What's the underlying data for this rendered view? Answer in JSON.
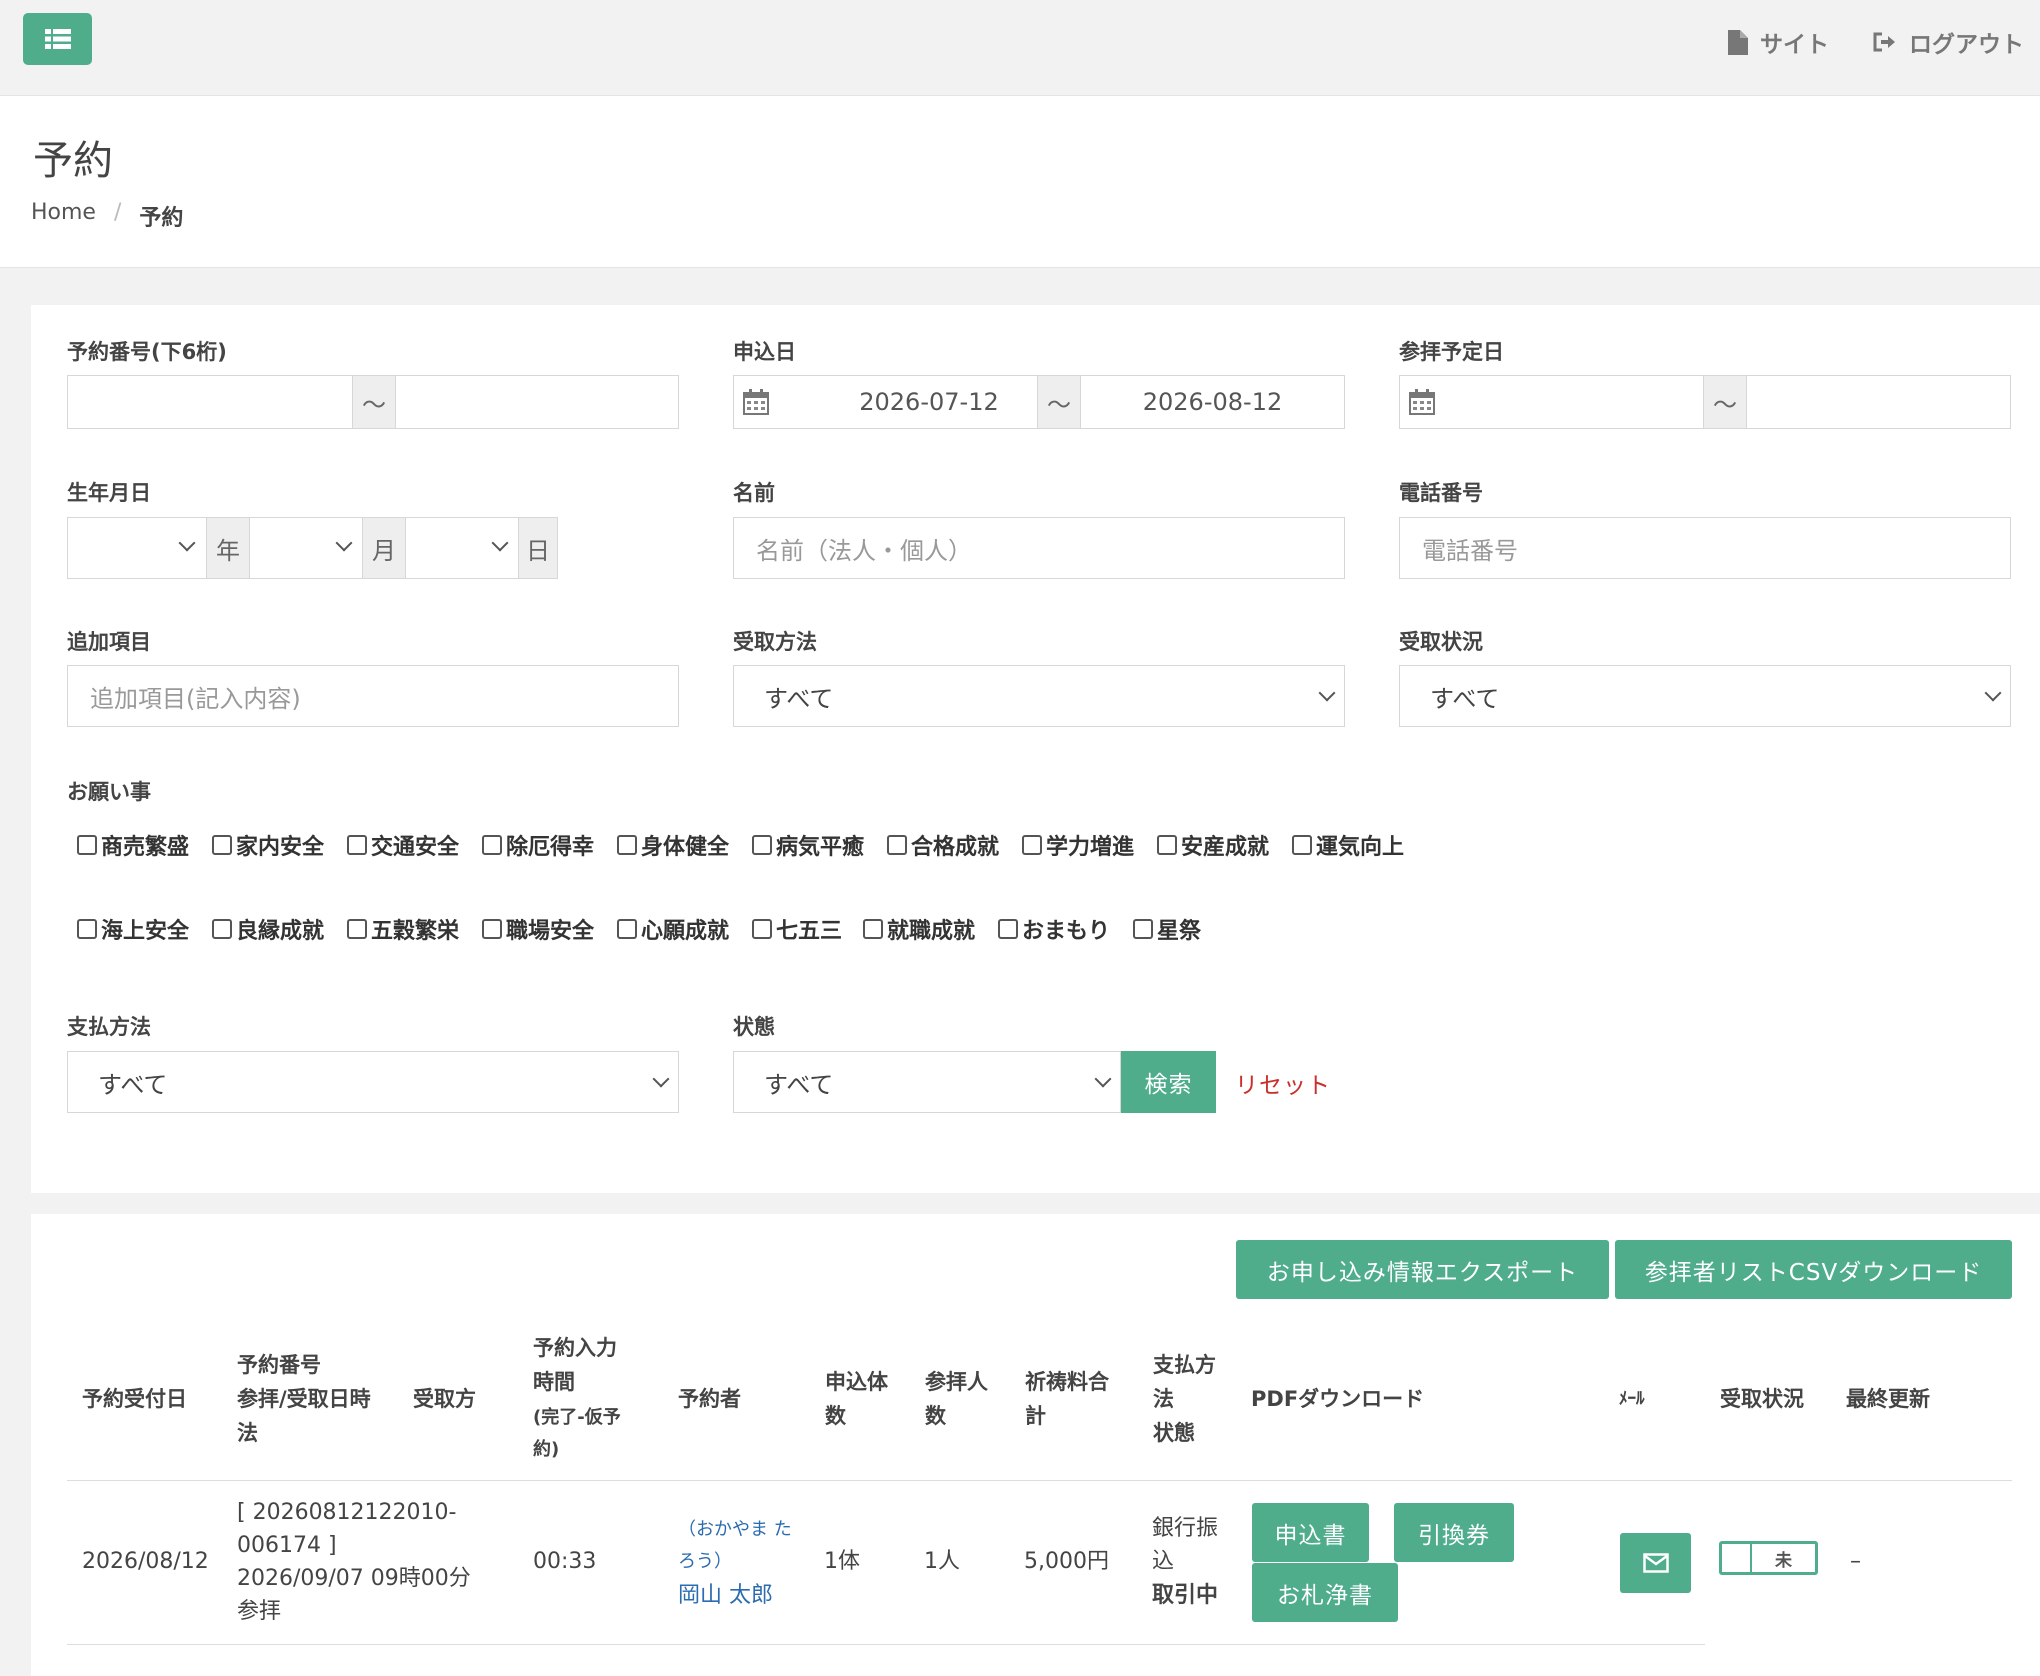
{
  "topbar": {
    "site_label": "サイト",
    "logout_label": "ログアウト",
    "accent": "#4fad8c"
  },
  "header": {
    "title": "予約",
    "breadcrumb": {
      "home": "Home",
      "separator": "/",
      "current": "予約"
    }
  },
  "filters": {
    "reservation_number": {
      "label": "予約番号(下6桁)",
      "range_sep": "〜"
    },
    "application_date": {
      "label": "申込日",
      "from": "2026-07-12",
      "to": "2026-08-12",
      "range_sep": "〜"
    },
    "visit_date": {
      "label": "参拝予定日",
      "range_sep": "〜"
    },
    "birthdate": {
      "label": "生年月日",
      "year_unit": "年",
      "month_unit": "月",
      "day_unit": "日"
    },
    "name": {
      "label": "名前",
      "placeholder": "名前（法人・個人）"
    },
    "phone": {
      "label": "電話番号",
      "placeholder": "電話番号"
    },
    "extra": {
      "label": "追加項目",
      "placeholder": "追加項目(記入内容)"
    },
    "receive_method": {
      "label": "受取方法",
      "value": "すべて"
    },
    "receive_status": {
      "label": "受取状況",
      "value": "すべて"
    },
    "wishes": {
      "label": "お願い事",
      "row1": [
        "商売繁盛",
        "家内安全",
        "交通安全",
        "除厄得幸",
        "身体健全",
        "病気平癒",
        "合格成就",
        "学力増進",
        "安産成就",
        "運気向上"
      ],
      "row2": [
        "海上安全",
        "良縁成就",
        "五穀繁栄",
        "職場安全",
        "心願成就",
        "七五三",
        "就職成就",
        "おまもり",
        "星祭"
      ]
    },
    "payment": {
      "label": "支払方法",
      "value": "すべて"
    },
    "status": {
      "label": "状態",
      "value": "すべて"
    },
    "search_label": "検索",
    "reset_label": "リセット"
  },
  "table_actions": {
    "export_label": "お申し込み情報エクスポート",
    "csv_label": "参拝者リストCSVダウンロード"
  },
  "table": {
    "headers": {
      "received_date": "予約受付日",
      "number_l1": "予約番号",
      "number_l2": "参拝/受取日時",
      "number_l3": "法",
      "receive_method": "受取方",
      "input_l1": "予約入力",
      "input_l2": "時間",
      "input_l3": "(完了-仮予",
      "input_l4": "約)",
      "reserver": "予約者",
      "units_l1": "申込体",
      "units_l2": "数",
      "people_l1": "参拝人",
      "people_l2": "数",
      "fee_l1": "祈祷料合",
      "fee_l2": "計",
      "pay_l1": "支払方",
      "pay_l2": "法",
      "pay_l3": "状態",
      "pdf": "PDFダウンロード",
      "mail": "ﾒｰﾙ",
      "receive_status": "受取状況",
      "updated": "最終更新"
    },
    "rows": [
      {
        "received_date": "2026/08/12",
        "number_l1": "[ 20260812122010-",
        "number_l2": "006174 ]",
        "visit_datetime": "2026/09/07 09時00分",
        "visit_type": "参拝",
        "input_time": "00:33",
        "kana_l1": "（おかやま た",
        "kana_l2": "ろう）",
        "name": "岡山 太郎",
        "units": "1体",
        "people": "1人",
        "fee": "5,000円",
        "pay_l1": "銀行振",
        "pay_l2": "込",
        "status": "取引中",
        "pdf_application": "申込書",
        "pdf_voucher": "引換券",
        "pdf_ofuda": "お札浄書",
        "receive_toggle": "未",
        "updated": "–"
      }
    ]
  }
}
